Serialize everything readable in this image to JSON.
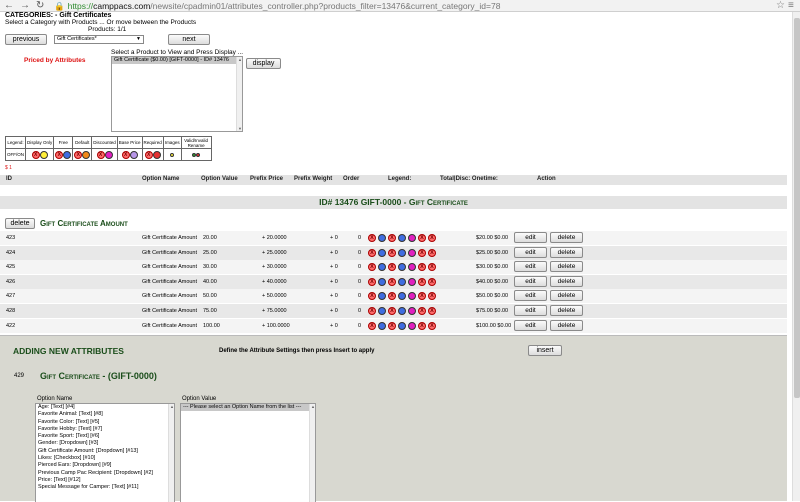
{
  "browser": {
    "url_scheme": "https://",
    "url_host": "camppacs.com",
    "url_path": "/newsite/cpadmin01/attributes_controller.php?products_filter=13476&current_category_id=78"
  },
  "header": {
    "categories_line": "CATEGORIES: - Gift Certificates",
    "select_category": "Select a Category with Products ... Or move between the Products",
    "products_count": "Products: 1/1",
    "previous_label": "previous",
    "category_selected": "Gift Certificates*",
    "next_label": "next",
    "priced_by": "Priced by Attributes",
    "select_product": "Select a Product to View and Press Display ...",
    "product_option": "Gift Certificate ($0.00) [GIFT-0000] - ID# 13476",
    "display_label": "display"
  },
  "legend": {
    "labels": [
      "Legend:",
      "Display Only",
      "Free",
      "Default",
      "Discounted",
      "Base Price",
      "Required",
      "Images",
      "Valid/Invalid Rename"
    ],
    "row_label": "OFF/ON",
    "colors": {
      "red": "#e53030",
      "yellow": "#ffef3a",
      "blue": "#3f6de0",
      "orange": "#f08a1a",
      "magenta": "#e020c0",
      "lavender": "#b897e8",
      "green": "#2c9a2c"
    }
  },
  "stray_mark": "$ 1",
  "table": {
    "headers": {
      "id": "ID",
      "option_name": "Option Name",
      "option_value": "Option Value",
      "prefix_price": "Prefix Price",
      "prefix_weight": "Prefix Weight",
      "order": "Order",
      "legend": "Legend:",
      "total": "Total|Disc: Onetime:",
      "action": "Action"
    },
    "product_title": "ID# 13476 GIFT-0000 - Gift Certificate",
    "delete_label": "delete",
    "edit_label": "edit",
    "group_title": "Gift Certificate Amount",
    "rows": [
      {
        "id": "423",
        "name": "Gift Certificate Amount",
        "value": "20.00",
        "price": "+ 20.0000",
        "weight": "+ 0",
        "order": "0",
        "total": "$20.00 $0.00"
      },
      {
        "id": "424",
        "name": "Gift Certificate Amount",
        "value": "25.00",
        "price": "+ 25.0000",
        "weight": "+ 0",
        "order": "0",
        "total": "$25.00 $0.00"
      },
      {
        "id": "425",
        "name": "Gift Certificate Amount",
        "value": "30.00",
        "price": "+ 30.0000",
        "weight": "+ 0",
        "order": "0",
        "total": "$30.00 $0.00"
      },
      {
        "id": "426",
        "name": "Gift Certificate Amount",
        "value": "40.00",
        "price": "+ 40.0000",
        "weight": "+ 0",
        "order": "0",
        "total": "$40.00 $0.00"
      },
      {
        "id": "427",
        "name": "Gift Certificate Amount",
        "value": "50.00",
        "price": "+ 50.0000",
        "weight": "+ 0",
        "order": "0",
        "total": "$50.00 $0.00"
      },
      {
        "id": "428",
        "name": "Gift Certificate Amount",
        "value": "75.00",
        "price": "+ 75.0000",
        "weight": "+ 0",
        "order": "0",
        "total": "$75.00 $0.00"
      },
      {
        "id": "422",
        "name": "Gift Certificate Amount",
        "value": "100.00",
        "price": "+ 100.0000",
        "weight": "+ 0",
        "order": "0",
        "total": "$100.00 $0.00"
      }
    ]
  },
  "new_attr": {
    "title": "ADDING NEW ATTRIBUTES",
    "instructions": "Define the Attribute Settings then press Insert to apply",
    "insert_label": "insert",
    "new_id": "429",
    "product_title": "Gift Certificate - (GIFT-0000)",
    "option_name_label": "Option Name",
    "option_value_label": "Option Value",
    "option_names": [
      "Age:  [Text]  [#4]",
      "Favorite Animal:  [Text]  [#8]",
      "Favorite Color:  [Text]  [#5]",
      "Favorite Hobby:  [Text]  [#7]",
      "Favorite Sport:  [Text]  [#6]",
      "Gender:  [Dropdown]  [#3]",
      "Gift Certificate Amount:  [Dropdown]  [#13]",
      "Likes:  [Checkbox]  [#10]",
      "Pierced Ears:  [Dropdown]  [#9]",
      "Previous Camp Pac Recipient:  [Dropdown]  [#2]",
      "Price:  [Text]  [#12]",
      "Special Message for Camper:  [Text]  [#11]"
    ],
    "option_value_placeholder": "--- Please select an Option Name from the list ---"
  }
}
